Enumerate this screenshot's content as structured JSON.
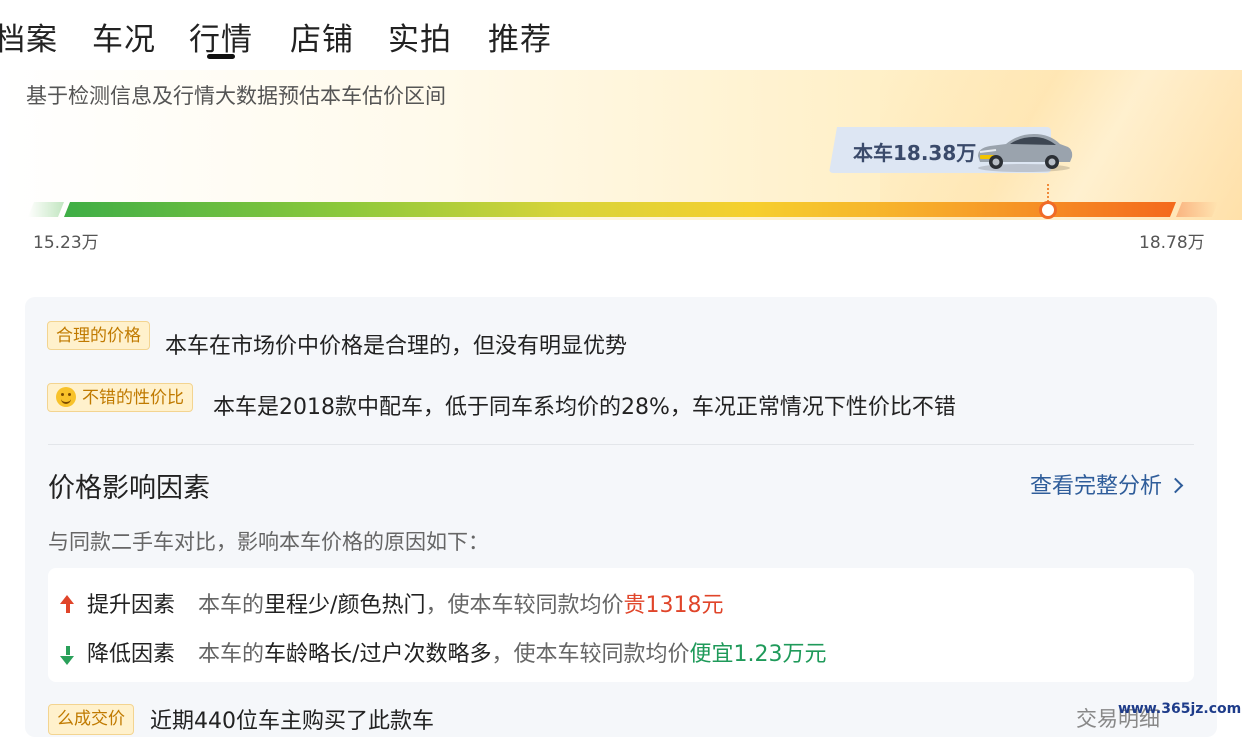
{
  "tabs": [
    {
      "label": "档案"
    },
    {
      "label": "车况"
    },
    {
      "label": "行情",
      "active": true
    },
    {
      "label": "店铺"
    },
    {
      "label": "实拍"
    },
    {
      "label": "推荐"
    }
  ],
  "estimate": {
    "subtitle": "基于检测信息及行情大数据预估本车估价区间",
    "current_price_label": "本车18.38万",
    "current_price_wan": 18.38,
    "range_low_label": "15.23万",
    "range_high_label": "18.78万",
    "range_low_wan": 15.23,
    "range_high_wan": 18.78
  },
  "assessment": {
    "reasonable_tag": "合理的价格",
    "reasonable_text": "本车在市场价中价格是合理的，但没有明显优势",
    "value_tag": "不错的性价比",
    "value_text": "本车是2018款中配车，低于同车系均价的28%，车况正常情况下性价比不错"
  },
  "factors": {
    "title": "价格影响因素",
    "link_label": "查看完整分析",
    "compare_text": "与同款二手车对比，影响本车价格的原因如下：",
    "raise": {
      "label": "提升因素",
      "prefix": "本车的",
      "reasons": "里程少/颜色热门",
      "middle": "，使本车较同款均价",
      "effect": "贵1318元"
    },
    "lower": {
      "label": "降低因素",
      "prefix": "本车的",
      "reasons": "车龄略长/过户次数略多",
      "middle": "，使本车较同款均价",
      "effect": "便宜1.23万元"
    }
  },
  "deals": {
    "tag": "么成交价",
    "text": "近期440位车主购买了此款车",
    "link_label": "交易明细"
  },
  "watermark": "www.365jz.com",
  "colors": {
    "accent_orange": "#f06a28",
    "link_blue": "#2f5d9a",
    "raise_red": "#e0452a",
    "lower_green": "#1f9a5a",
    "tag_gold": "#c07a00"
  }
}
